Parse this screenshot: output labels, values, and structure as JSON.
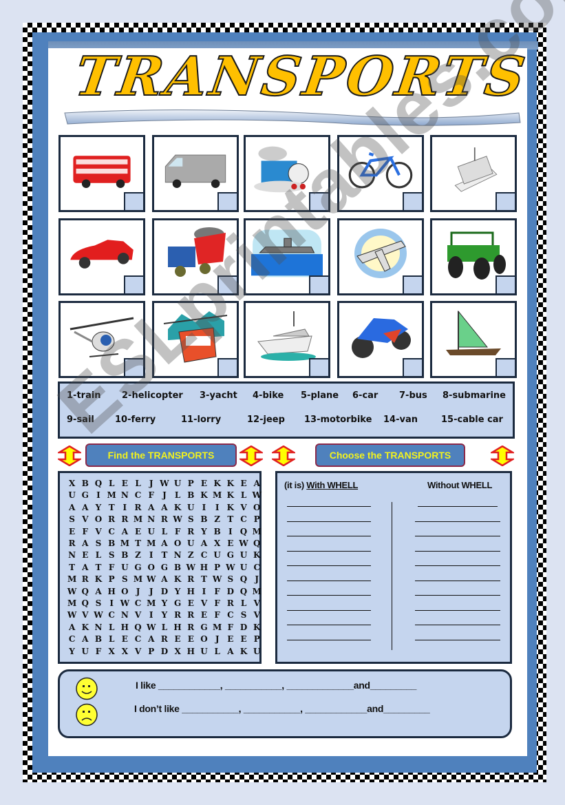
{
  "title": "TRANSPORTS",
  "pictures": [
    {
      "icon": "double-decker-bus-icon",
      "alt": "bus"
    },
    {
      "icon": "van-icon",
      "alt": "van"
    },
    {
      "icon": "train-icon",
      "alt": "train"
    },
    {
      "icon": "bicycle-icon",
      "alt": "bike"
    },
    {
      "icon": "ferry-icon",
      "alt": "ferry"
    },
    {
      "icon": "car-icon",
      "alt": "car"
    },
    {
      "icon": "lorry-icon",
      "alt": "lorry"
    },
    {
      "icon": "submarine-icon",
      "alt": "submarine"
    },
    {
      "icon": "plane-icon",
      "alt": "plane"
    },
    {
      "icon": "jeep-icon",
      "alt": "jeep"
    },
    {
      "icon": "helicopter-icon",
      "alt": "helicopter"
    },
    {
      "icon": "cable-car-icon",
      "alt": "cable car"
    },
    {
      "icon": "yacht-icon",
      "alt": "yacht"
    },
    {
      "icon": "motorbike-icon",
      "alt": "motorbike"
    },
    {
      "icon": "sailboat-icon",
      "alt": "sail"
    }
  ],
  "word_bank": [
    "1-train",
    "2-helicopter",
    "3-yacht",
    "4-bike",
    "5-plane",
    "6-car",
    "7-bus",
    "8-submarine",
    "9-sail",
    "10-ferry",
    "11-lorry",
    "12-jeep",
    "13-motorbike",
    "14-van",
    "15-cable car"
  ],
  "sections": {
    "find_label": "Find the TRANSPORTS",
    "choose_label": "Choose the TRANSPORTS"
  },
  "word_search": [
    "XBQLELJWUPEKKEA",
    "UGIMNCFJLBKMKLW",
    "AAYTIRAAKUIIKVO",
    "SVORRMNRWSBZTCP",
    "EFVCAEULFRYBIQM",
    "RASBMTMAOUAXEWQ",
    "NELSBZITNZCUGUK",
    "TATFUGOGBWHPWUC",
    "MRKPSMWAKRTWSQJ",
    "WQAHOJJDYHIFDQM",
    "MQSIWCMYGEVFRLV",
    "WVWCNVIYRREFCSV",
    "AKNLHQWLHRGMFDK",
    "CABLECAREEOJEEP",
    "YUFXXVPDXHULAKU"
  ],
  "sorting": {
    "prefix": "(it is) ",
    "with_label": "With WHELL",
    "without_label": "Without WHELL",
    "blank_lines_per_column": 10
  },
  "preferences": {
    "like_text": "I like ____________, ___________, _____________and_________",
    "dislike_text": "I don’t like ___________, ___________, ____________and_________"
  },
  "watermark": "ESLprintables.com",
  "colors": {
    "title_fill": "#ffc000",
    "banner_bg": "#4f81bd",
    "banner_text": "#f2f21e",
    "panel_bg": "#c5d5ee",
    "border_dark": "#1b2a3f"
  }
}
